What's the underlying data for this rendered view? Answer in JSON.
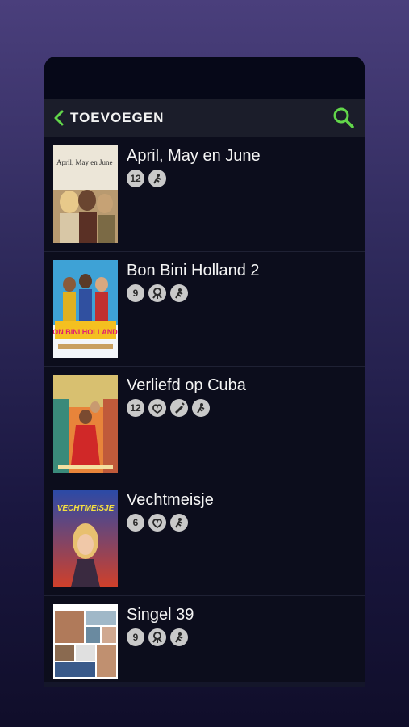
{
  "header": {
    "title": "TOEVOEGEN"
  },
  "movies": [
    {
      "title": "April, May en June",
      "age": "12",
      "icons": [
        "age-12-icon",
        "fear-icon"
      ]
    },
    {
      "title": "Bon Bini Holland 2",
      "age": "9",
      "icons": [
        "age-9-icon",
        "discrimination-icon",
        "fear-icon"
      ]
    },
    {
      "title": "Verliefd op Cuba",
      "age": "12",
      "icons": [
        "age-12-icon",
        "sex-icon",
        "drugs-icon",
        "fear-icon"
      ]
    },
    {
      "title": "Vechtmeisje",
      "age": "6",
      "icons": [
        "age-6-icon",
        "sex-icon",
        "fear-icon"
      ]
    },
    {
      "title": "Singel 39",
      "age": "9",
      "icons": [
        "age-9-icon",
        "discrimination-icon",
        "fear-icon"
      ]
    }
  ],
  "poster_text": {
    "april": "April, May en June",
    "bonbini": "BON BINI HOLLAND 2",
    "vecht": "VECHTMEISJE"
  },
  "colors": {
    "accent": "#62d64a",
    "badge": "#c9c9c9",
    "panel": "#0a0b1e"
  }
}
